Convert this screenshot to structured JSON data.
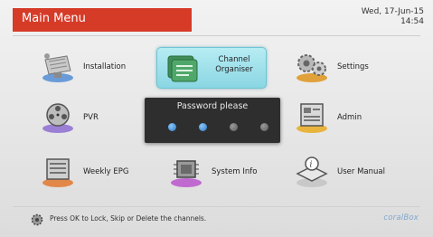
{
  "header": {
    "title": "Main Menu",
    "date": "Wed, 17-Jun-15",
    "time": "14:54"
  },
  "menu": {
    "installation": "Installation",
    "channel_organiser": "Channel Organiser",
    "settings": "Settings",
    "pvr": "PVR",
    "admin": "Admin",
    "weekly_epg": "Weekly EPG",
    "system_info": "System Info",
    "user_manual": "User Manual"
  },
  "dialog": {
    "title": "Password please",
    "digits_entered": 2,
    "digits_total": 4
  },
  "footer": {
    "hint": "Press OK to Lock, Skip or Delete the channels.",
    "brand": "coralBox"
  },
  "colors": {
    "title_bar": "#d63b28",
    "selected_tile": "#8ad6e3",
    "dialog_bg": "#2e2e2e",
    "dot_filled": "#2a78c8",
    "dot_empty": "#5a5a5a",
    "brand": "#7fa6cf"
  },
  "icons": {
    "installation": "satellite-dish-icon",
    "channel_organiser": "channel-list-icon",
    "settings": "gears-icon",
    "pvr": "film-reel-icon",
    "admin": "admin-panel-icon",
    "weekly_epg": "epg-guide-icon",
    "system_info": "chip-info-icon",
    "user_manual": "manual-book-icon",
    "footer": "gear-hint-icon"
  }
}
